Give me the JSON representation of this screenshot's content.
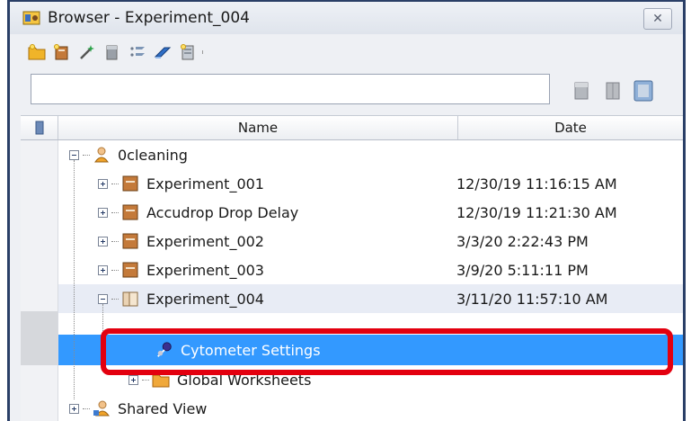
{
  "window": {
    "title": "Browser - Experiment_004",
    "close_label": "✕"
  },
  "toolbar": {
    "buttons": [
      {
        "icon": "new-folder-icon"
      },
      {
        "icon": "new-experiment-icon"
      },
      {
        "icon": "settings-wand-icon"
      },
      {
        "icon": "new-specimen-icon"
      },
      {
        "icon": "new-tube-icon"
      },
      {
        "icon": "new-worksheet-icon"
      },
      {
        "icon": "new-layout-icon"
      }
    ]
  },
  "search": {
    "value": "",
    "placeholder": ""
  },
  "table": {
    "columns": [
      "Name",
      "Date"
    ],
    "rows": [
      {
        "name": "0cleaning",
        "date": "",
        "level": 0,
        "expander": "minus",
        "icon": "user-icon"
      },
      {
        "name": "Experiment_001",
        "date": "12/30/19 11:16:15 AM",
        "level": 1,
        "expander": "plus",
        "icon": "experiment-icon"
      },
      {
        "name": "Accudrop Drop Delay",
        "date": "12/30/19 11:21:30 AM",
        "level": 1,
        "expander": "plus",
        "icon": "experiment-icon"
      },
      {
        "name": "Experiment_002",
        "date": "3/3/20 2:22:43 PM",
        "level": 1,
        "expander": "plus",
        "icon": "experiment-icon"
      },
      {
        "name": "Experiment_003",
        "date": "3/9/20 5:11:11 PM",
        "level": 1,
        "expander": "plus",
        "icon": "experiment-icon"
      },
      {
        "name": "Experiment_004",
        "date": "3/11/20 11:57:10 AM",
        "level": 1,
        "expander": "minus",
        "icon": "experiment-open-icon"
      },
      {
        "name": "Cytometer Settings",
        "date": "",
        "level": 2,
        "expander": "none",
        "icon": "cytometer-settings-icon",
        "selected": true
      },
      {
        "name": "Global Worksheets",
        "date": "",
        "level": 2,
        "expander": "plus",
        "icon": "global-worksheets-icon"
      },
      {
        "name": "Shared View",
        "date": "",
        "level": 0,
        "expander": "plus",
        "icon": "shared-user-icon"
      }
    ]
  },
  "colors": {
    "selection": "#3399ff",
    "highlight_box": "#e3000f",
    "window_border": "#2a3f67"
  }
}
